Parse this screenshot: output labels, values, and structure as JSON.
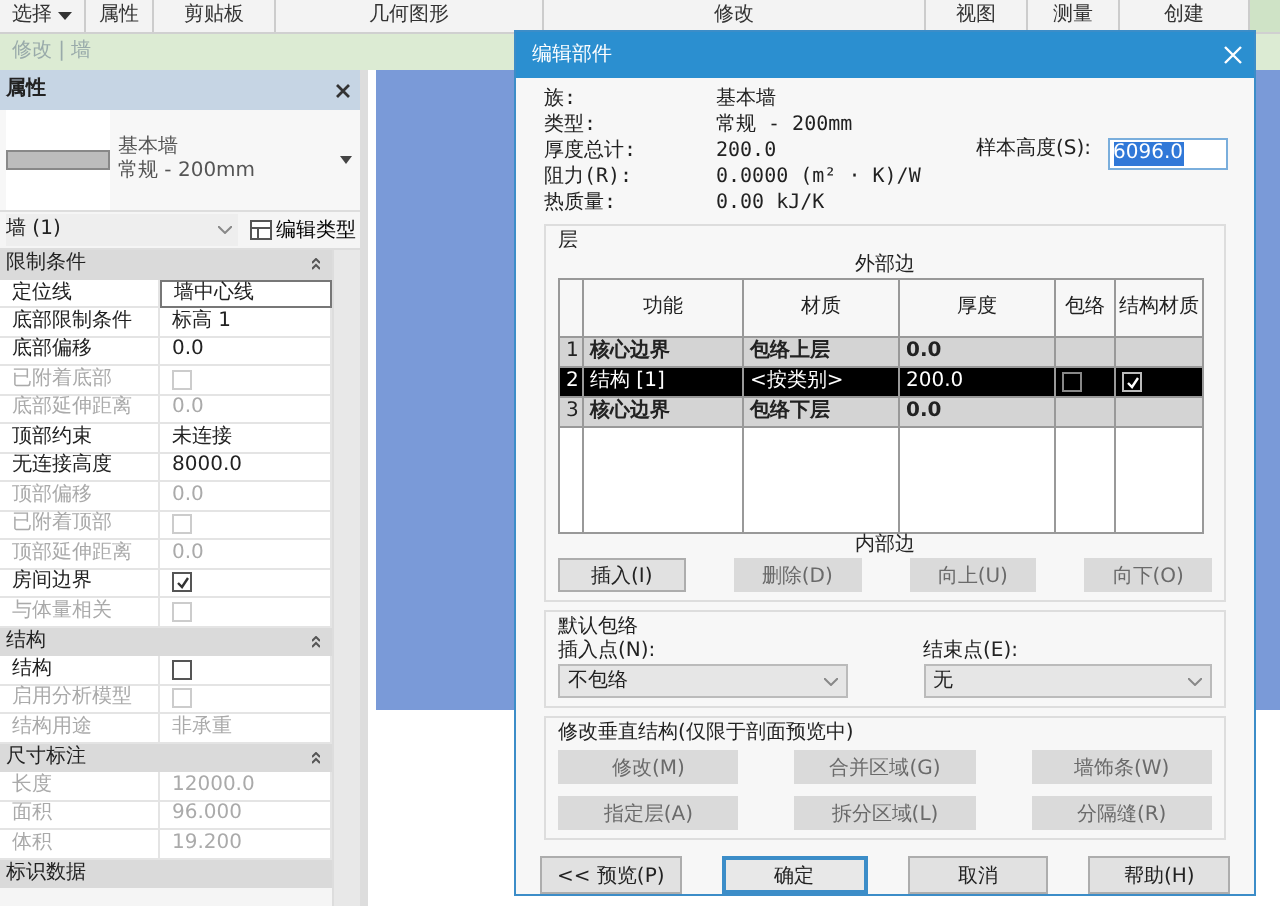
{
  "ribbon": {
    "tabs": [
      {
        "label": "选择",
        "kind": "dropdown"
      },
      {
        "label": "属性",
        "kind": "panel"
      },
      {
        "label": "剪贴板",
        "kind": "panel"
      },
      {
        "label": "几何图形",
        "kind": "panel"
      },
      {
        "label": "修改",
        "kind": "panel"
      },
      {
        "label": "视图",
        "kind": "panel"
      },
      {
        "label": "测量",
        "kind": "panel"
      },
      {
        "label": "创建",
        "kind": "panel"
      }
    ],
    "context": "修改 | 墙"
  },
  "properties": {
    "title": "属性",
    "type": {
      "family": "基本墙",
      "name": "常规 - 200mm"
    },
    "instance": "墙 (1)",
    "edit_type": "编辑类型",
    "groups": [
      {
        "title": "限制条件",
        "rows": [
          {
            "label": "定位线",
            "kind": "text",
            "value": "墙中心线",
            "disabled": false,
            "selected": true
          },
          {
            "label": "底部限制条件",
            "kind": "text",
            "value": "标高 1",
            "disabled": false,
            "selected": false
          },
          {
            "label": "底部偏移",
            "kind": "text",
            "value": "0.0",
            "disabled": false,
            "selected": false
          },
          {
            "label": "已附着底部",
            "kind": "checkbox",
            "checked": false,
            "disabled": true,
            "selected": false
          },
          {
            "label": "底部延伸距离",
            "kind": "text",
            "value": "0.0",
            "disabled": true,
            "selected": false
          },
          {
            "label": "顶部约束",
            "kind": "text",
            "value": "未连接",
            "disabled": false,
            "selected": false
          },
          {
            "label": "无连接高度",
            "kind": "text",
            "value": "8000.0",
            "disabled": false,
            "selected": false
          },
          {
            "label": "顶部偏移",
            "kind": "text",
            "value": "0.0",
            "disabled": true,
            "selected": false
          },
          {
            "label": "已附着顶部",
            "kind": "checkbox",
            "checked": false,
            "disabled": true,
            "selected": false
          },
          {
            "label": "顶部延伸距离",
            "kind": "text",
            "value": "0.0",
            "disabled": true,
            "selected": false
          },
          {
            "label": "房间边界",
            "kind": "checkbox",
            "checked": true,
            "disabled": false,
            "selected": false
          },
          {
            "label": "与体量相关",
            "kind": "checkbox",
            "checked": false,
            "disabled": true,
            "selected": false
          }
        ]
      },
      {
        "title": "结构",
        "rows": [
          {
            "label": "结构",
            "kind": "checkbox",
            "checked": false,
            "disabled": false,
            "selected": false
          },
          {
            "label": "启用分析模型",
            "kind": "checkbox",
            "checked": false,
            "disabled": true,
            "selected": false
          },
          {
            "label": "结构用途",
            "kind": "text",
            "value": "非承重",
            "disabled": true,
            "selected": false
          }
        ]
      },
      {
        "title": "尺寸标注",
        "rows": [
          {
            "label": "长度",
            "kind": "text",
            "value": "12000.0",
            "disabled": true,
            "selected": false
          },
          {
            "label": "面积",
            "kind": "text",
            "value": "96.000",
            "disabled": true,
            "selected": false
          },
          {
            "label": "体积",
            "kind": "text",
            "value": "19.200",
            "disabled": true,
            "selected": false
          }
        ]
      },
      {
        "title": "标识数据"
      }
    ]
  },
  "dialog": {
    "title": "编辑部件",
    "info": [
      {
        "label": "族:",
        "value": "基本墙"
      },
      {
        "label": "类型:",
        "value": "常规 - 200mm"
      },
      {
        "label": "厚度总计:",
        "value": "200.0"
      },
      {
        "label": "阻力(R):",
        "value": "0.0000 (m² · K)/W"
      },
      {
        "label": "热质量:",
        "value": "0.00 kJ/K"
      }
    ],
    "sample_height": {
      "label": "样本高度(S):",
      "value": "6096.0"
    },
    "layers": {
      "title": "层",
      "top_label": "外部边",
      "bottom_label": "内部边",
      "columns": [
        "功能",
        "材质",
        "厚度",
        "包络",
        "结构材质"
      ],
      "rows": [
        {
          "index": "1",
          "function": "核心边界",
          "material": "包络上层",
          "thickness": "0.0",
          "selected": false
        },
        {
          "index": "2",
          "function": "结构 [1]",
          "material": "<按类别>",
          "thickness": "200.0",
          "wraps": false,
          "structural_material": true,
          "selected": true
        },
        {
          "index": "3",
          "function": "核心边界",
          "material": "包络下层",
          "thickness": "0.0",
          "selected": false
        }
      ],
      "buttons": [
        {
          "label": "插入(I)",
          "disabled": false
        },
        {
          "label": "删除(D)",
          "disabled": true
        },
        {
          "label": "向上(U)",
          "disabled": true
        },
        {
          "label": "向下(O)",
          "disabled": true
        }
      ]
    },
    "default_wrapping": {
      "title": "默认包络",
      "insert": {
        "label": "插入点(N):",
        "value": "不包络"
      },
      "end": {
        "label": "结束点(E):",
        "value": "无"
      }
    },
    "vertical": {
      "title": "修改垂直结构(仅限于剖面预览中)",
      "buttons": [
        {
          "label": "修改(M)",
          "disabled": true
        },
        {
          "label": "合并区域(G)",
          "disabled": true
        },
        {
          "label": "墙饰条(W)",
          "disabled": true
        },
        {
          "label": "指定层(A)",
          "disabled": true
        },
        {
          "label": "拆分区域(L)",
          "disabled": true
        },
        {
          "label": "分隔缝(R)",
          "disabled": true
        }
      ]
    },
    "footer": [
      {
        "label": "<< 预览(P)",
        "default": false
      },
      {
        "label": "确定",
        "default": true
      },
      {
        "label": "取消",
        "default": false
      },
      {
        "label": "帮助(H)",
        "default": false
      }
    ]
  }
}
